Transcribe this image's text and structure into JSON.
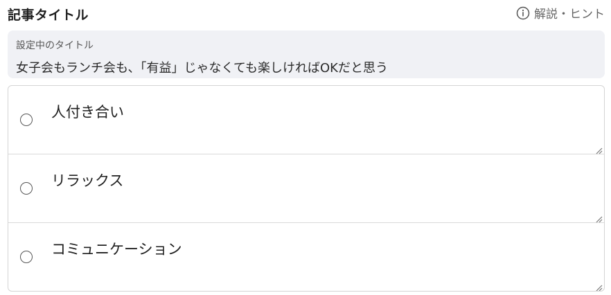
{
  "header": {
    "title": "記事タイトル",
    "hint_label": "解説・ヒント"
  },
  "current_title": {
    "label": "設定中のタイトル",
    "value": "女子会もランチ会も、「有益」じゃなくても楽しければOKだと思う"
  },
  "options": [
    {
      "text": "人付き合い",
      "selected": false
    },
    {
      "text": "リラックス",
      "selected": false
    },
    {
      "text": "コミュニケーション",
      "selected": false
    }
  ],
  "icons": {
    "hint": "info-icon",
    "radio": "radio-icon",
    "resize": "resize-grip-icon"
  },
  "colors": {
    "current_title_bg": "#f0f1f5",
    "border": "#d4d4d4",
    "hint_text": "#666666"
  }
}
